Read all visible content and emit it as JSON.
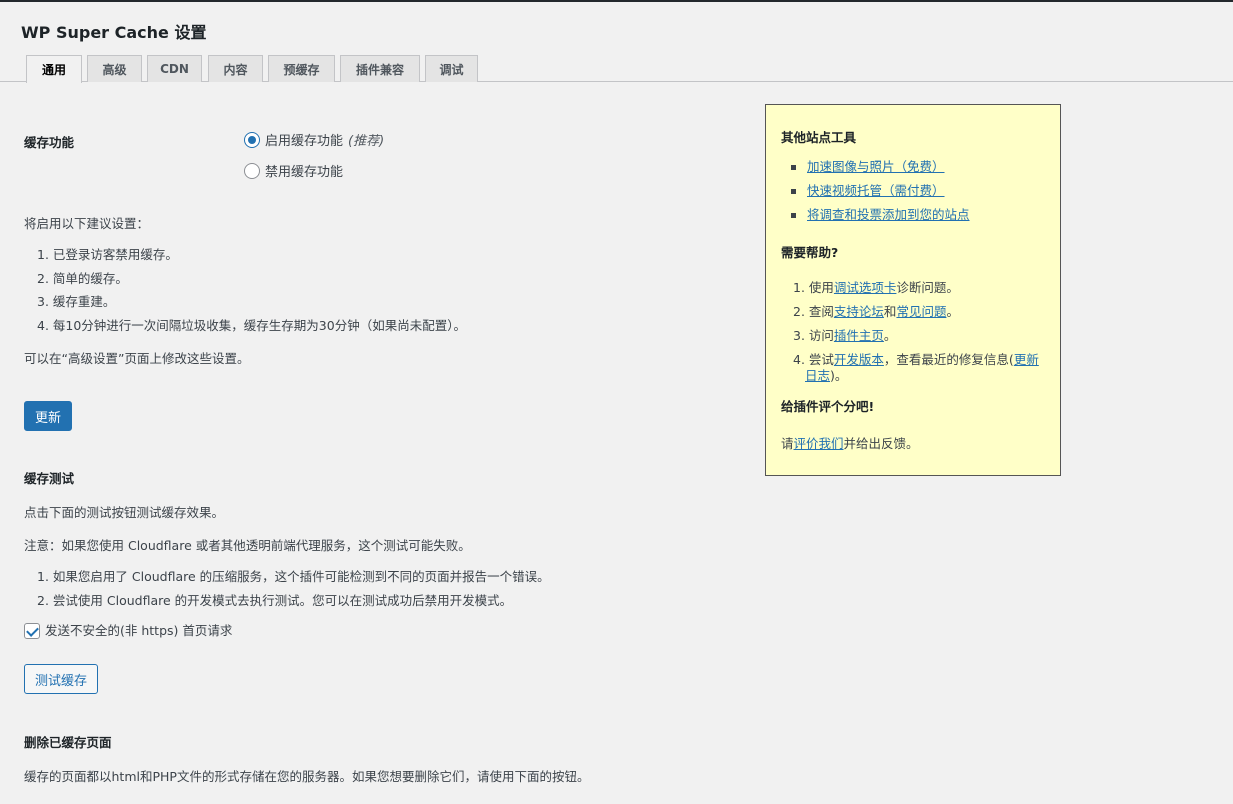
{
  "page": {
    "title_prefix": "WP Super Cache",
    "title_suffix": " 设置"
  },
  "tabs": [
    "通用",
    "高级",
    "CDN",
    "内容",
    "预缓存",
    "插件兼容",
    "调试"
  ],
  "caching": {
    "label": "缓存功能",
    "option_on": "启用缓存功能",
    "option_on_note": "(推荐)",
    "option_off": "禁用缓存功能",
    "selected": "on"
  },
  "recommend": {
    "intro": "将启用以下建议设置：",
    "items": [
      "1. 已登录访客禁用缓存。",
      "2. 简单的缓存。",
      "3. 缓存重建。",
      "4. 每10分钟进行一次间隔垃圾收集，缓存生存期为30分钟（如果尚未配置）。"
    ],
    "footer": "可以在“高级设置”页面上修改这些设置。"
  },
  "update_button": "更新",
  "cache_test": {
    "heading": "缓存测试",
    "desc": "点击下面的测试按钮测试缓存效果。",
    "note": "注意：如果您使用 Cloudflare 或者其他透明前端代理服务，这个测试可能失败。",
    "items": [
      "1. 如果您启用了 Cloudflare 的压缩服务，这个插件可能检测到不同的页面并报告一个错误。",
      "2. 尝试使用 Cloudflare 的开发模式去执行测试。您可以在测试成功后禁用开发模式。"
    ],
    "checkbox_label": "发送不安全的(非 https) 首页请求",
    "checkbox_checked": true,
    "button": "测试缓存"
  },
  "delete_cache": {
    "heading": "删除已缓存页面",
    "desc": "缓存的页面都以html和PHP文件的形式存储在您的服务器。如果您想要删除它们，请使用下面的按钮。"
  },
  "sidebar": {
    "tools_heading": "其他站点工具",
    "tools": [
      "加速图像与照片（免费）",
      "快速视频托管（需付费）",
      "将调查和投票添加到您的站点"
    ],
    "help_heading": "需要帮助?",
    "help": {
      "i1_pre": "1. 使用",
      "i1_link": "调试选项卡",
      "i1_post": "诊断问题。",
      "i2_pre": "2. 查阅",
      "i2_link1": "支持论坛",
      "i2_mid": "和",
      "i2_link2": "常见问题",
      "i2_post": "。",
      "i3_pre": "3. 访问",
      "i3_link": "插件主页",
      "i3_post": "。",
      "i4_pre": "4. 尝试",
      "i4_link1": "开发版本",
      "i4_mid": "，查看最近的修复信息(",
      "i4_link2": "更新日志",
      "i4_post": ")。"
    },
    "rate_heading": "给插件评个分吧!",
    "rate_pre": "请",
    "rate_link": "评价我们",
    "rate_post": "并给出反馈。"
  }
}
